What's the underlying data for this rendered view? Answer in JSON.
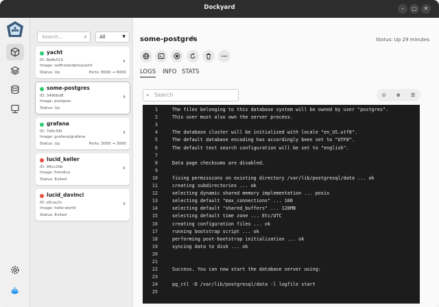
{
  "window": {
    "title": "Dockyard"
  },
  "sidebar": {
    "search_placeholder": "Search...",
    "filter_value": "All"
  },
  "containers": [
    {
      "name": "yacht",
      "id": "ID: 8e8e515",
      "image": "Image: selfhostedpro/yacht",
      "status": "Status: Up",
      "ports": "Ports: 8000 → 8000",
      "state_color": "#2ecc71"
    },
    {
      "name": "some-postgres",
      "id": "ID: 3490bd8",
      "image": "Image: postgres",
      "status": "Status: Up",
      "ports": "",
      "state_color": "#2ecc71"
    },
    {
      "name": "grafana",
      "id": "ID: 7d0c59f",
      "image": "Image: grafana/grafana",
      "status": "Status: Up",
      "ports": "Ports: 3000 → 3000",
      "state_color": "#2ecc71"
    },
    {
      "name": "lucid_keller",
      "id": "ID: 99cc20b",
      "image": "Image: frendica",
      "status": "Status: Exited",
      "ports": "",
      "state_color": "#e74c3c"
    },
    {
      "name": "lucid_davinci",
      "id": "ID: a5cac2c",
      "image": "Image: hello-world",
      "status": "Status: Exited",
      "ports": "",
      "state_color": "#e74c3c"
    }
  ],
  "detail": {
    "name": "some-postgres",
    "status": "Status: Up 29 minutes",
    "tabs": [
      "LOGS",
      "INFO",
      "STATS"
    ],
    "log_search_placeholder": "Search"
  },
  "logs": [
    {
      "n": "1",
      "t": "The files belonging to this database system will be owned by user \"postgres\"."
    },
    {
      "n": "2",
      "t": "This user must also own the server process."
    },
    {
      "n": "3",
      "t": ""
    },
    {
      "n": "4",
      "t": "The database cluster will be initialized with locale \"en_US.utf8\"."
    },
    {
      "n": "5",
      "t": "The default database encoding has accordingly been set to \"UTF8\"."
    },
    {
      "n": "6",
      "t": "The default text search configuration will be set to \"english\"."
    },
    {
      "n": "7",
      "t": ""
    },
    {
      "n": "8",
      "t": "Data page checksums are disabled."
    },
    {
      "n": "9",
      "t": ""
    },
    {
      "n": "10",
      "t": "fixing permissions on existing directory /var/lib/postgresql/data ... ok"
    },
    {
      "n": "11",
      "t": "creating subdirectories ... ok"
    },
    {
      "n": "12",
      "t": "selecting dynamic shared memory implementation ... posix"
    },
    {
      "n": "13",
      "t": "selecting default \"max_connections\" ... 100"
    },
    {
      "n": "14",
      "t": "selecting default \"shared_buffers\" ... 128MB"
    },
    {
      "n": "15",
      "t": "selecting default time zone ... Etc/UTC"
    },
    {
      "n": "16",
      "t": "creating configuration files ... ok"
    },
    {
      "n": "17",
      "t": "running bootstrap script ... ok"
    },
    {
      "n": "18",
      "t": "performing post-bootstrap initialization ... ok"
    },
    {
      "n": "19",
      "t": "syncing data to disk ... ok"
    },
    {
      "n": "20",
      "t": ""
    },
    {
      "n": "21",
      "t": ""
    },
    {
      "n": "22",
      "t": "Success. You can now start the database server using:"
    },
    {
      "n": "23",
      "t": ""
    },
    {
      "n": "24",
      "t": "pg_ctl -D /var/lib/postgresql/data -l logfile start"
    },
    {
      "n": "25",
      "t": ""
    }
  ]
}
